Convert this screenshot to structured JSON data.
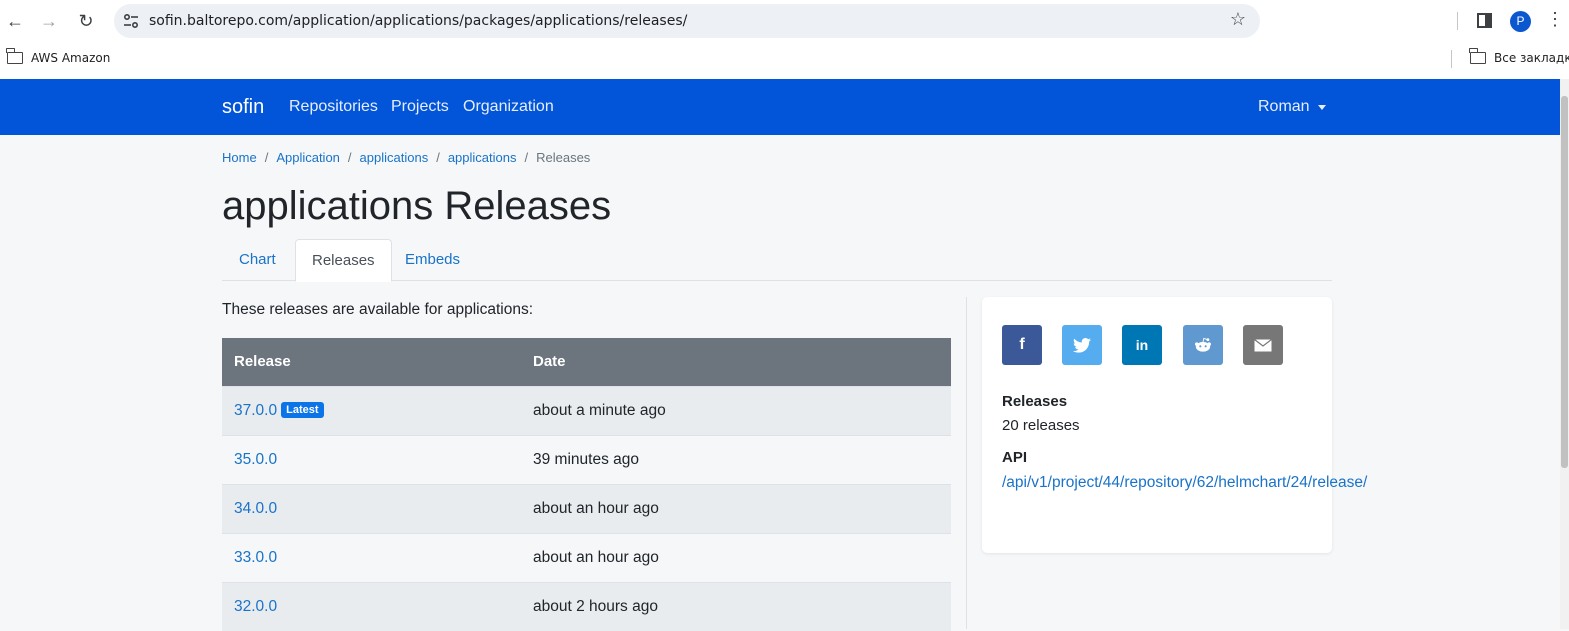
{
  "browser": {
    "url": "sofin.baltorepo.com/application/applications/packages/applications/releases/",
    "profile_initial": "P",
    "bookmarks": [
      "AWS Amazon"
    ],
    "all_bookmarks_label": "Все закладки"
  },
  "navbar": {
    "brand": "sofin",
    "links": [
      "Repositories",
      "Projects",
      "Organization"
    ],
    "user": "Roman"
  },
  "breadcrumb": {
    "items": [
      "Home",
      "Application",
      "applications",
      "applications"
    ],
    "active": "Releases"
  },
  "page_title": "applications Releases",
  "tabs": [
    "Chart",
    "Releases",
    "Embeds"
  ],
  "active_tab": "Releases",
  "intro": "These releases are available for applications:",
  "table": {
    "headers": [
      "Release",
      "Date"
    ],
    "latest_badge": "Latest",
    "rows": [
      {
        "release": "37.0.0",
        "date": "about a minute ago"
      },
      {
        "release": "35.0.0",
        "date": "39 minutes ago"
      },
      {
        "release": "34.0.0",
        "date": "about an hour ago"
      },
      {
        "release": "33.0.0",
        "date": "about an hour ago"
      },
      {
        "release": "32.0.0",
        "date": "about 2 hours ago"
      }
    ]
  },
  "sidebar": {
    "share_icons": [
      "facebook-icon",
      "twitter-icon",
      "linkedin-icon",
      "reddit-icon",
      "email-icon"
    ],
    "releases_label": "Releases",
    "releases_count": "20 releases",
    "api_label": "API",
    "api_link": "/api/v1/project/44/repository/62/helmchart/24/release/"
  },
  "colors": {
    "navbar": "#0254d8",
    "link": "#1a73c8",
    "table_header": "#6c757d",
    "badge": "#0a74e8"
  }
}
